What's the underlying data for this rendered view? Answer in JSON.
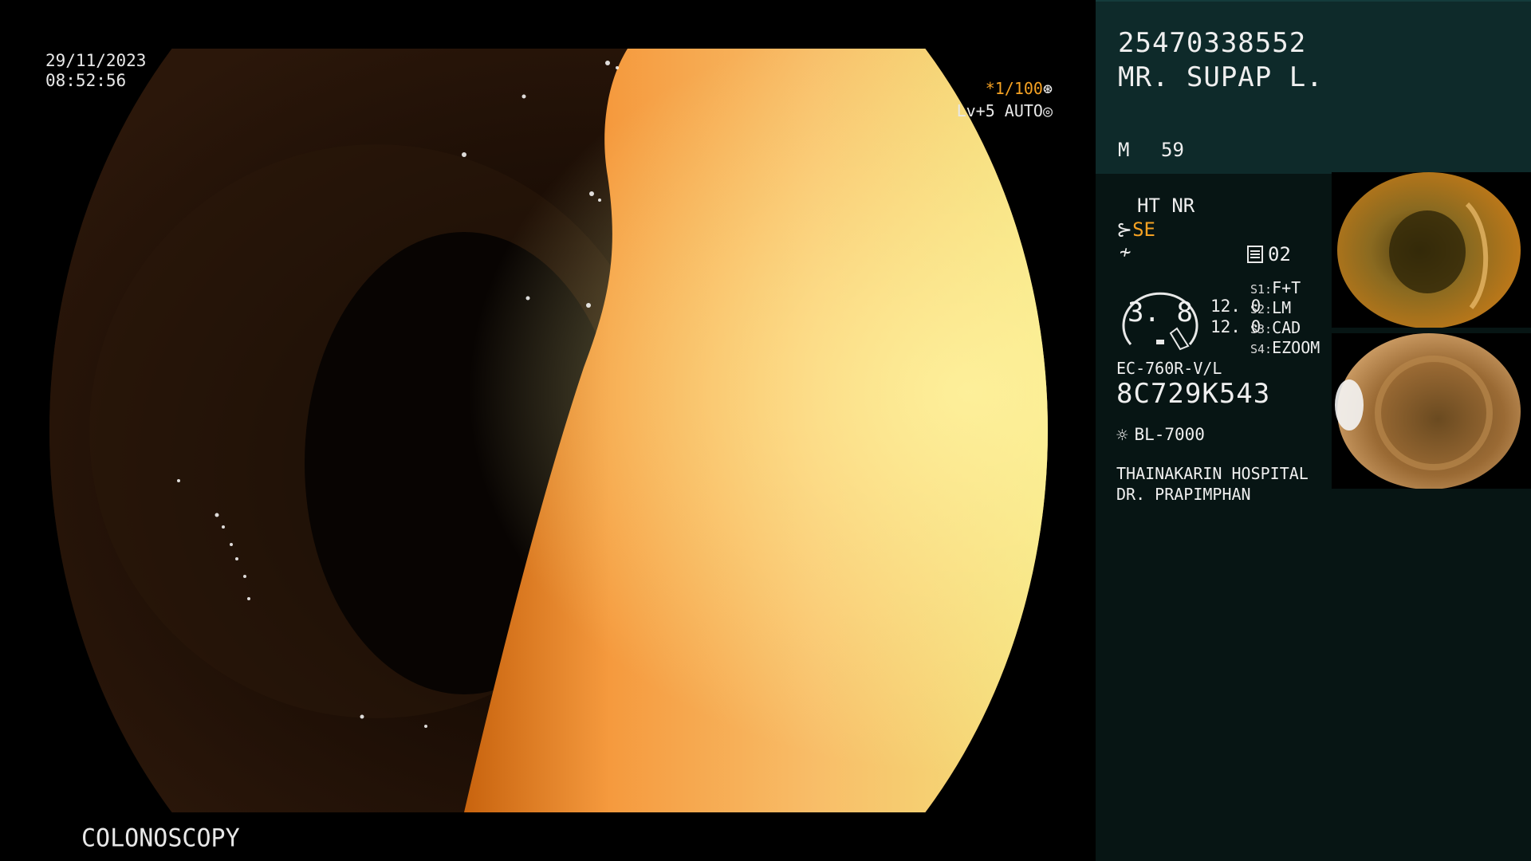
{
  "overlay": {
    "date": "29/11/2023",
    "time": "08:52:56",
    "shutter": "*1/100",
    "level": "Lv+5 AUTO",
    "procedure": "COLONOSCOPY",
    "page_number": "2"
  },
  "patient": {
    "id": "25470338552",
    "name": "MR. SUPAP L.",
    "sex": "M",
    "age": "59"
  },
  "settings": {
    "ht_nr": "HT NR",
    "se": "SE",
    "memory": "02",
    "gauge_value": "3. 8",
    "pressure_1": "12. 0",
    "pressure_2": "12. 0",
    "switches": [
      {
        "key": "S1:",
        "value": "F+T"
      },
      {
        "key": "S2:",
        "value": "LM"
      },
      {
        "key": "S3:",
        "value": "CAD"
      },
      {
        "key": "S4:",
        "value": "EZOOM"
      }
    ]
  },
  "equipment": {
    "scope_model": "EC-760R-V/L",
    "scope_serial": "8C729K543",
    "light_source": "BL-7000"
  },
  "facility": {
    "hospital": "THAINAKARIN HOSPITAL",
    "doctor": "DR. PRAPIMPHAN"
  },
  "icons": {
    "shutter_ring": "aperture-icon",
    "level_ring": "target-icon",
    "se_prefix": "scissors-icon",
    "ff_prefix": "slash-icon",
    "memory": "memory-icon",
    "light": "lamp-icon"
  },
  "colors": {
    "accent_orange": "#f5a223",
    "panel_top": "#0e2a2a",
    "panel_body": "#071514"
  }
}
